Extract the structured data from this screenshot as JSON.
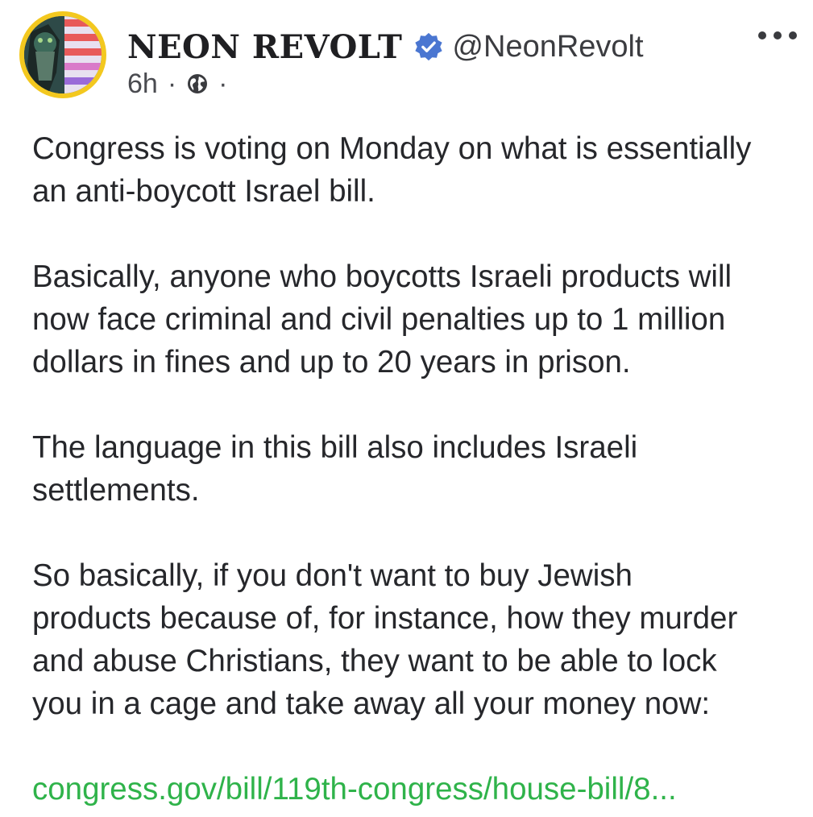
{
  "post": {
    "author": {
      "display_name": "NEON REVOLT",
      "verified_icon": "verified-badge-icon",
      "handle": "@NeonRevolt"
    },
    "meta": {
      "time": "6h",
      "separator": "·",
      "visibility_icon": "globe-icon"
    },
    "menu_icon": "more-options-icon",
    "paragraphs": [
      "Congress is voting on Monday on what is essentially\nan anti-boycott Israel bill.",
      "Basically, anyone who boycotts Israeli products will\nnow face criminal and civil penalties up to 1 million\ndollars in fines and up to 20 years in prison.",
      "The language in this bill also includes Israeli\nsettlements.",
      "So basically, if you don't want to buy Jewish\nproducts because of, for instance, how they murder\nand abuse Christians, they want to be able to lock\nyou in a cage and take away all your money now:"
    ],
    "link_text": "congress.gov/bill/119th-congress/house-bill/8..."
  },
  "colors": {
    "link": "#2fb34a",
    "verified": "#4a76d1",
    "avatar_ring": "#f3c81f"
  }
}
